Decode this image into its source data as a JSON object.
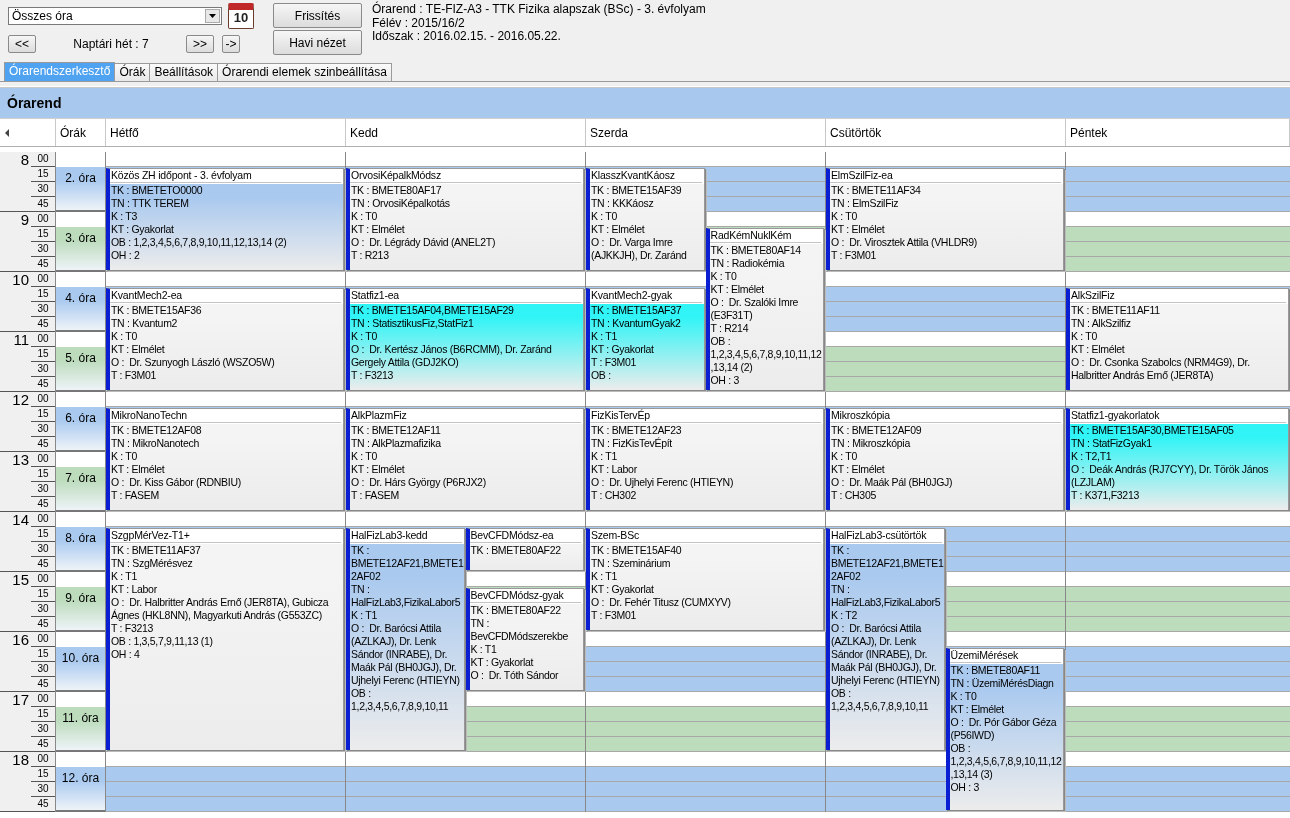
{
  "toolbar": {
    "filter": {
      "value": "Összes óra"
    },
    "calendar_day": "10",
    "prev_button": "<<",
    "week_label": "Naptári hét : 7",
    "next_button": ">>",
    "jump_button": "->",
    "refresh_button": "Frissítés",
    "month_view_button": "Havi nézet"
  },
  "info": [
    "Órarend : TE-FIZ-A3 - TTK Fizika alapszak (BSc) - 3. évfolyam",
    "Félév : 2015/16/2",
    "Időszak : 2016.02.15. - 2016.05.22."
  ],
  "tabs": [
    {
      "label": "Órarendszerkesztő",
      "selected": true
    },
    {
      "label": "Órák",
      "selected": false
    },
    {
      "label": "Beállítások",
      "selected": false
    },
    {
      "label": "Órarendi elemek szinbeállítása",
      "selected": false
    }
  ],
  "panel_title": "Órarend",
  "grid": {
    "periods_header": "Órák",
    "hours": [
      {
        "hour": "8",
        "minutes": [
          "00",
          "15",
          "30",
          "45"
        ]
      },
      {
        "hour": "9",
        "minutes": [
          "00",
          "15",
          "30",
          "45"
        ]
      },
      {
        "hour": "10",
        "minutes": [
          "00",
          "15",
          "30",
          "45"
        ]
      },
      {
        "hour": "11",
        "minutes": [
          "00",
          "15",
          "30",
          "45"
        ]
      },
      {
        "hour": "12",
        "minutes": [
          "00",
          "15",
          "30",
          "45"
        ]
      },
      {
        "hour": "13",
        "minutes": [
          "00",
          "15",
          "30",
          "45"
        ]
      },
      {
        "hour": "14",
        "minutes": [
          "00",
          "15",
          "30",
          "45"
        ]
      },
      {
        "hour": "15",
        "minutes": [
          "00",
          "15",
          "30",
          "45"
        ]
      },
      {
        "hour": "16",
        "minutes": [
          "00",
          "15",
          "30",
          "45"
        ]
      },
      {
        "hour": "17",
        "minutes": [
          "00",
          "15",
          "30",
          "45"
        ]
      },
      {
        "hour": "18",
        "minutes": [
          "00",
          "15",
          "30",
          "45"
        ]
      }
    ],
    "periods": [
      {
        "label": "2. óra",
        "color": "#a9c9ef"
      },
      {
        "label": "3. óra",
        "color": "#bcdcbc"
      },
      {
        "label": "4. óra",
        "color": "#a9c9ef"
      },
      {
        "label": "5. óra",
        "color": "#bcdcbc"
      },
      {
        "label": "6. óra",
        "color": "#a9c9ef"
      },
      {
        "label": "7. óra",
        "color": "#bcdcbc"
      },
      {
        "label": "8. óra",
        "color": "#a9c9ef"
      },
      {
        "label": "9. óra",
        "color": "#bcdcbc"
      },
      {
        "label": "10. óra",
        "color": "#a9c9ef"
      },
      {
        "label": "11. óra",
        "color": "#bcdcbc"
      },
      {
        "label": "12. óra",
        "color": "#a9c9ef"
      }
    ],
    "days": [
      {
        "label": "Hétfő",
        "events": [
          {
            "title": "Közös ZH időpont - 3. évfolyam",
            "color": "#a9c9ef",
            "lines": [
              "TK : BMETETO0000",
              "TN : TTK TEREM",
              "K : T3",
              "KT : Gyakorlat",
              "OB : 1,2,3,4,5,6,7,8,9,10,11,12,13,14 (2)",
              "OH : 2"
            ]
          },
          {
            "title": "KvantMech2-ea",
            "color": "#f4f4f4",
            "lines": [
              "TK : BMETE15AF36",
              "TN : Kvantum2",
              "K : T0",
              "KT : Elmélet",
              "O :  Dr. Szunyogh László (WSZO5W)",
              "T : F3M01"
            ]
          },
          {
            "title": "MikroNanoTechn",
            "color": "#f4f4f4",
            "lines": [
              "TK : BMETE12AF08",
              "TN : MikroNanotech",
              "K : T0",
              "KT : Elmélet",
              "O :  Dr. Kiss Gábor (RDNBIU)",
              "T : FASEM"
            ]
          },
          {
            "title": "SzgpMérVez-T1+",
            "color": "#f4f4f4",
            "lines": [
              "TK : BMETE11AF37",
              "TN : SzgMérésvez",
              "K : T1",
              "KT : Labor",
              "O :  Dr. Halbritter András Ernő (JER8TA), Gubicza Ágnes (HKL8NN), Magyarkuti András (G553ZC)",
              "T : F3213",
              "OB : 1,3,5,7,9,11,13 (1)",
              "OH : 4"
            ]
          }
        ]
      },
      {
        "label": "Kedd",
        "events": [
          {
            "title": "OrvosiKépalkMódsz",
            "color": "#f4f4f4",
            "lines": [
              "TK : BMETE80AF17",
              "TN : OrvosiKépalkotás",
              "K : T0",
              "KT : Elmélet",
              "O :  Dr. Légrády Dávid (ANEL2T)",
              "T : R213"
            ]
          },
          {
            "title": "Statfiz1-ea",
            "color": "#30f4f6",
            "lines": [
              "TK : BMETE15AF04,BMETE15AF29",
              "TN : StatisztikusFiz,StatFiz1",
              "K : T0",
              "O :  Dr. Kertész János (B6RCMM), Dr. Zaránd Gergely Attila (GDJ2KO)",
              "T : F3213"
            ]
          },
          {
            "title": "AlkPlazmFiz",
            "color": "#f4f4f4",
            "lines": [
              "TK : BMETE12AF11",
              "TN : AlkPlazmafizika",
              "K : T0",
              "KT : Elmélet",
              "O :  Dr. Hárs György (P6RJX2)",
              "T : FASEM"
            ]
          },
          {
            "title": "HalFizLab3-kedd",
            "color": "#a9c9ef",
            "lines": [
              "TK : BMETE12AF21,BMETE12AF02",
              "TN : HalFizLab3,FizikaLabor5",
              "K : T1",
              "O :  Dr. Barócsi Attila (AZLKAJ), Dr. Lenk Sándor (INRABE), Dr. Maák Pál (BH0JGJ), Dr. Ujhelyi Ferenc (HTIEYN)",
              "OB : 1,2,3,4,5,6,7,8,9,10,11"
            ]
          },
          {
            "title": "BevCFDMódsz-ea",
            "color": "#f4f4f4",
            "lines": [
              "TK : BMETE80AF22"
            ]
          },
          {
            "title": "BevCFDMódsz-gyak",
            "color": "#f4f4f4",
            "lines": [
              "TK : BMETE80AF22",
              "TN : BevCFDMódszerekbe",
              "K : T1",
              "KT : Gyakorlat",
              "O :  Dr. Tóth Sándor"
            ]
          }
        ]
      },
      {
        "label": "Szerda",
        "events": [
          {
            "title": "KlasszKvantKáosz",
            "color": "#f4f4f4",
            "lines": [
              "TK : BMETE15AF39",
              "TN : KKKáosz",
              "K : T0",
              "KT : Elmélet",
              "O :  Dr. Varga Imre (AJKKJH), Dr. Zaránd"
            ]
          },
          {
            "title": "KvantMech2-gyak",
            "color": "#30f4f6",
            "lines": [
              "TK : BMETE15AF37",
              "TN : KvantumGyak2",
              "K : T1",
              "KT : Gyakorlat",
              "T : F3M01",
              "OB :"
            ]
          },
          {
            "title": "RadKémNuklKém",
            "color": "#f4f4f4",
            "lines": [
              "TK : BMETE80AF14",
              "TN : Radiokémia",
              "K : T0",
              "KT : Elmélet",
              "O :  Dr. Szalóki Imre (E3F31T)",
              "T : R214",
              "OB : 1,2,3,4,5,6,7,8,9,10,11,12,13,14 (2)",
              "OH : 3"
            ]
          },
          {
            "title": "FizKisTervÉp",
            "color": "#f4f4f4",
            "lines": [
              "TK : BMETE12AF23",
              "TN : FizKisTevÉpít",
              "K : T1",
              "KT : Labor",
              "O :  Dr. Ujhelyi Ferenc (HTIEYN)",
              "T : CH302"
            ]
          },
          {
            "title": "Szem-BSc",
            "color": "#f4f4f4",
            "lines": [
              "TK : BMETE15AF40",
              "TN : Szeminárium",
              "K : T1",
              "KT : Gyakorlat",
              "O :  Dr. Fehér Titusz (CUMXYV)",
              "T : F3M01"
            ]
          }
        ]
      },
      {
        "label": "Csütörtök",
        "events": [
          {
            "title": "ElmSzilFiz-ea",
            "color": "#f4f4f4",
            "lines": [
              "TK : BMETE11AF34",
              "TN : ElmSzilFiz",
              "K : T0",
              "KT : Elmélet",
              "O :  Dr. Virosztek Attila (VHLDR9)",
              "T : F3M01"
            ]
          },
          {
            "title": "Mikroszkópia",
            "color": "#f4f4f4",
            "lines": [
              "TK : BMETE12AF09",
              "TN : Mikroszkópia",
              "K : T0",
              "KT : Elmélet",
              "O :  Dr. Maák Pál (BH0JGJ)",
              "T : CH305"
            ]
          },
          {
            "title": "HalFizLab3-csütörtök",
            "color": "#a9c9ef",
            "lines": [
              "TK : BMETE12AF21,BMETE12AF02",
              "TN : HalFizLab3,FizikaLabor5",
              "K : T2",
              "O :  Dr. Barócsi Attila (AZLKAJ), Dr. Lenk Sándor (INRABE), Dr. Maák Pál (BH0JGJ), Dr. Ujhelyi Ferenc (HTIEYN)",
              "OB : 1,2,3,4,5,6,7,8,9,10,11"
            ]
          },
          {
            "title": "ÜzemiMérések",
            "color": "#a9c9ef",
            "lines": [
              "TK : BMETE80AF11",
              "TN : ÜzemiMérésDiagn",
              "K : T0",
              "KT : Elmélet",
              "O :  Dr. Pór Gábor Géza (P56IWD)",
              "OB : 1,2,3,4,5,6,7,8,9,10,11,12,13,14 (3)",
              "OH : 3"
            ]
          }
        ]
      },
      {
        "label": "Péntek",
        "events": [
          {
            "title": "AlkSzilFiz",
            "color": "#f4f4f4",
            "lines": [
              "TK : BMETE11AF11",
              "TN : AlkSzilfiz",
              "K : T0",
              "KT : Elmélet",
              "O :  Dr. Csonka Szabolcs (NRM4G9), Dr. Halbritter András Ernő (JER8TA)"
            ]
          },
          {
            "title": "Statfiz1-gyakorlatok",
            "color": "#30f4f6",
            "lines": [
              "TK : BMETE15AF30,BMETE15AF05",
              "TN : StatFizGyak1",
              "K : T2,T1",
              "O :  Deák András (RJ7CYY), Dr. Török János (LZJLAM)",
              "T : K371,F3213"
            ]
          }
        ]
      }
    ]
  }
}
